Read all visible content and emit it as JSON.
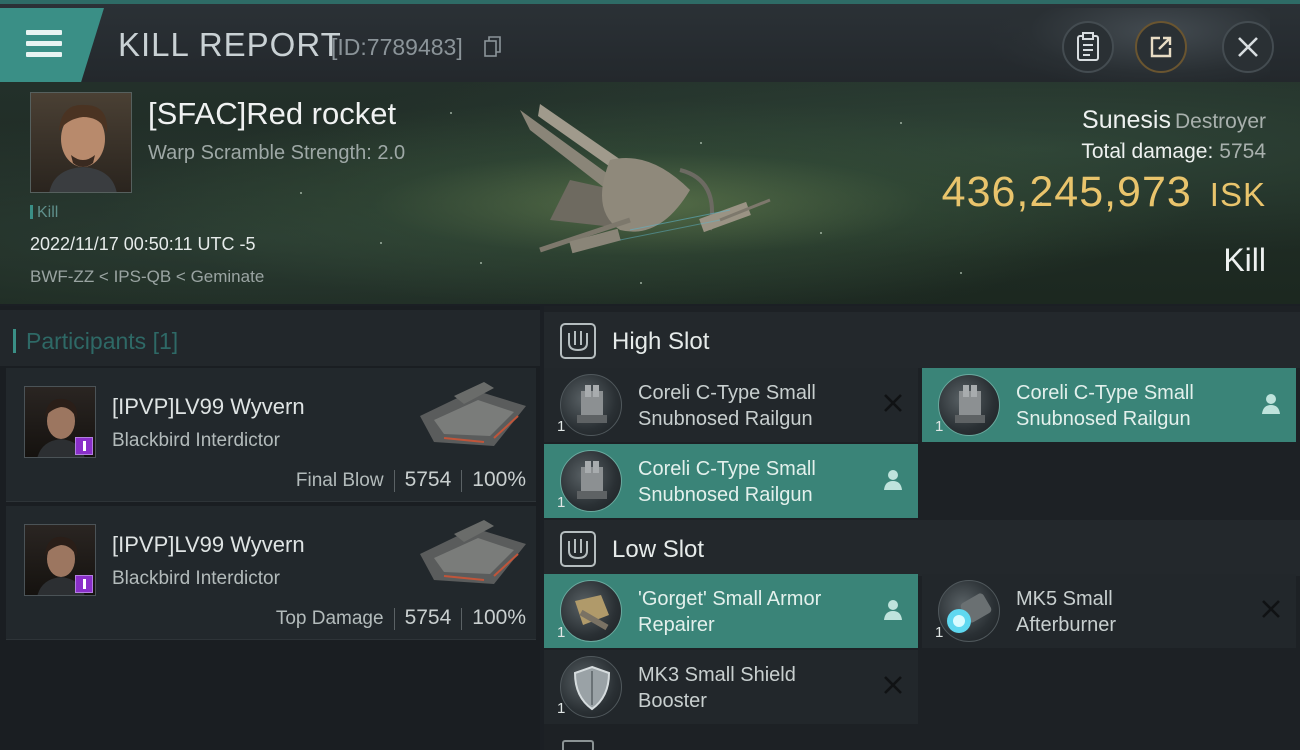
{
  "header": {
    "title": "KILL REPORT",
    "report_id": "[ID:7789483]"
  },
  "victim": {
    "name": "[SFAC]Red rocket",
    "warp_scramble": "Warp Scramble Strength: 2.0",
    "tag": "Kill",
    "datetime": "2022/11/17 00:50:11 UTC -5",
    "location": "BWF-ZZ < IPS-QB < Geminate",
    "ship_name": "Sunesis",
    "ship_class": "Destroyer",
    "total_damage_label": "Total damage:",
    "total_damage": "5754",
    "isk_value": "436,245,973",
    "isk_unit": "ISK",
    "result": "Kill"
  },
  "participants": {
    "title": "Participants",
    "count": "[1]",
    "items": [
      {
        "name": "[IPVP]LV99 Wyvern",
        "ship": "Blackbird Interdictor",
        "label": "Final Blow",
        "damage": "5754",
        "percent": "100%"
      },
      {
        "name": "[IPVP]LV99 Wyvern",
        "ship": "Blackbird Interdictor",
        "label": "Top Damage",
        "damage": "5754",
        "percent": "100%"
      }
    ]
  },
  "fitting": {
    "high_slot": {
      "label": "High Slot",
      "modules": [
        {
          "name_line1": "Coreli C-Type Small",
          "name_line2": "Snubnosed Railgun",
          "qty": "1",
          "state": "destroyed"
        },
        {
          "name_line1": "Coreli C-Type Small",
          "name_line2": "Snubnosed Railgun",
          "qty": "1",
          "state": "dropped"
        },
        {
          "name_line1": "Coreli C-Type Small",
          "name_line2": "Snubnosed Railgun",
          "qty": "1",
          "state": "dropped"
        }
      ]
    },
    "low_slot": {
      "label": "Low Slot",
      "modules": [
        {
          "name_line1": "'Gorget' Small Armor",
          "name_line2": "Repairer",
          "qty": "1",
          "state": "dropped"
        },
        {
          "name_line1": "MK5 Small",
          "name_line2": "Afterburner",
          "qty": "1",
          "state": "destroyed"
        },
        {
          "name_line1": "MK3 Small Shield",
          "name_line2": "Booster",
          "qty": "1",
          "state": "destroyed"
        }
      ]
    }
  },
  "colors": {
    "accent_teal": "#3a8f86",
    "dropped_row": "#3a8478",
    "isk_gold": "#e9c46c"
  }
}
